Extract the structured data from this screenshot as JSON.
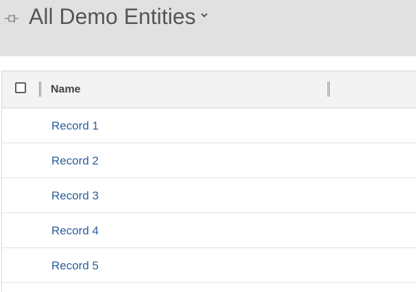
{
  "view": {
    "title": "All Demo Entities",
    "pin_icon": "pin-icon",
    "chevron_icon": "chevron-down-icon"
  },
  "grid": {
    "select_all_icon": "checkbox-icon",
    "columns": [
      {
        "label": "Name"
      }
    ],
    "rows": [
      {
        "name": "Record 1"
      },
      {
        "name": "Record 2"
      },
      {
        "name": "Record 3"
      },
      {
        "name": "Record 4"
      },
      {
        "name": "Record 5"
      }
    ]
  },
  "colors": {
    "header_bg": "#e1e1e1",
    "title_text": "#555555",
    "grid_header_bg": "#f3f3f3",
    "link": "#2b5e99"
  }
}
